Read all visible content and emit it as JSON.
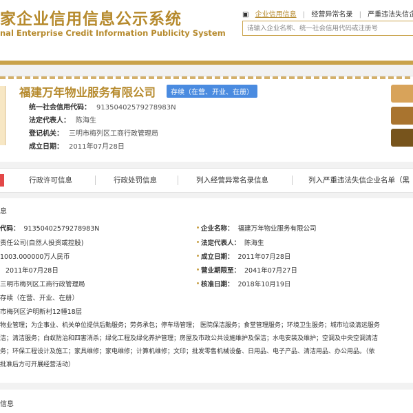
{
  "header": {
    "title_cn": "家企业信用信息公示系统",
    "title_en": "nal Enterprise Credit Information Publicity System",
    "nav": [
      "企业信用信息",
      "经营异常名录",
      "严重违法失信企"
    ],
    "search_placeholder": "请输入企业名称、统一社会信用代码或注册号"
  },
  "company": {
    "name": "福建万年物业服务有限公司",
    "status": "存续（在营、开业、在册）",
    "fields": [
      {
        "label": "统一社会信用代码：",
        "value": "91350402579278983N"
      },
      {
        "label": "法定代表人：",
        "value": "陈海生"
      },
      {
        "label": "登记机关：",
        "value": "三明市梅列区工商行政管理局"
      },
      {
        "label": "成立日期：",
        "value": "2011年07月28日"
      }
    ],
    "side_colors": [
      "#d8a35a",
      "#a9742f",
      "#77541c"
    ]
  },
  "tabs": [
    "行政许可信息",
    "行政处罚信息",
    "列入经营异常名录信息",
    "列入严重违法失信企业名单（黑"
  ],
  "basic": {
    "section_title": "息",
    "left": [
      {
        "label": "代码：",
        "value": "91350402579278983N"
      },
      {
        "label": "",
        "value": "责任公司(自然人投资或控股)"
      },
      {
        "label": "",
        "value": "1003.000000万人民币"
      },
      {
        "label": "",
        "value": "2011年07月28日"
      },
      {
        "label": "",
        "value": "三明市梅列区工商行政管理局"
      },
      {
        "label": "",
        "value": "存续（在营、开业、在册）"
      },
      {
        "label": "",
        "value": "市梅列区沪明新村12幢18层"
      }
    ],
    "right": [
      {
        "label": "企业名称：",
        "value": "福建万年物业服务有限公司"
      },
      {
        "label": "法定代表人：",
        "value": "陈海生"
      },
      {
        "label": "成立日期：",
        "value": "2011年07月28日"
      },
      {
        "label": "营业期限至：",
        "value": "2041年07月27日"
      },
      {
        "label": "核准日期：",
        "value": "2018年10月19日"
      }
    ],
    "scope": [
      "物业管理；为企事业、机关单位提供后勤服务；劳务承包；停车场管理； 医院保洁服务；食堂管理服务；环境卫生服务；城市垃圾清运服务",
      "洁；清洁服务；白蚁防治和四害消杀；绿化工程及绿化养护管理；房屋及市政公共设施维护及保洁；水电安装及维护；空调及中央空调清洁",
      "务；环保工程设计及施工；家具维修；家电维修；计算机维修；文印；批发零售机械设备、日用品、电子产品、清洁用品、办公用品。（依",
      "批准后方可开展经营活动）"
    ]
  },
  "bottom": {
    "title": "信息"
  }
}
